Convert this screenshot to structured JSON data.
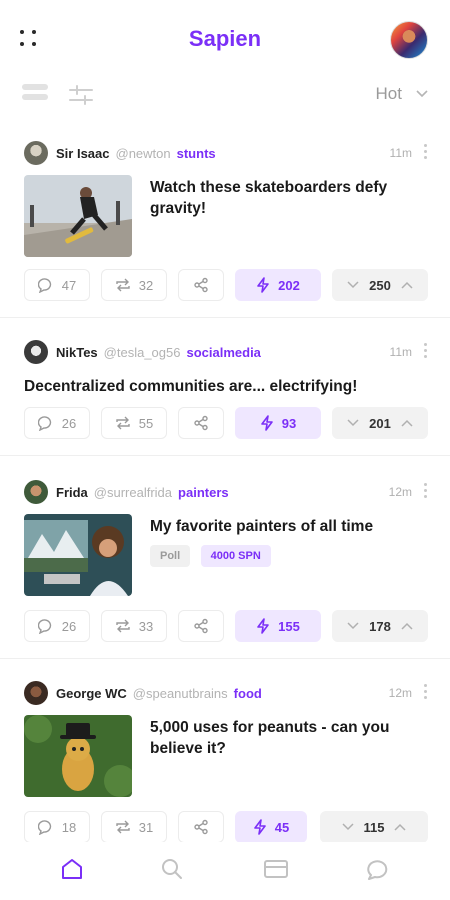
{
  "header": {
    "title": "Sapien"
  },
  "toolbar": {
    "sort_label": "Hot"
  },
  "colors": {
    "accent": "#7b2ff7",
    "accent_soft": "#efe7ff",
    "muted": "#9a9a9a"
  },
  "posts": [
    {
      "username": "Sir Isaac",
      "handle": "@newton",
      "community": "stunts",
      "time": "11m",
      "title": "Watch these skateboarders defy gravity!",
      "thumbnail": "skateboarder-image",
      "comments": "47",
      "reposts": "32",
      "boosts": "202",
      "votes": "250"
    },
    {
      "username": "NikTes",
      "handle": "@tesla_og56",
      "community": "socialmedia",
      "time": "11m",
      "title": "Decentralized communities are... electrifying!",
      "comments": "26",
      "reposts": "55",
      "boosts": "93",
      "votes": "201"
    },
    {
      "username": "Frida",
      "handle": "@surrealfrida",
      "community": "painters",
      "time": "12m",
      "title": "My favorite painters of all time",
      "thumbnail": "painter-image",
      "tags": [
        "Poll",
        "4000 SPN"
      ],
      "comments": "26",
      "reposts": "33",
      "boosts": "155",
      "votes": "178"
    },
    {
      "username": "George WC",
      "handle": "@speanutbrains",
      "community": "food",
      "time": "12m",
      "title": "5,000 uses for peanuts - can you believe it?",
      "thumbnail": "peanut-image",
      "comments": "18",
      "reposts": "31",
      "boosts": "45",
      "votes": "115"
    }
  ],
  "nav": [
    "home-icon",
    "search-icon",
    "wallet-icon",
    "chat-icon"
  ]
}
